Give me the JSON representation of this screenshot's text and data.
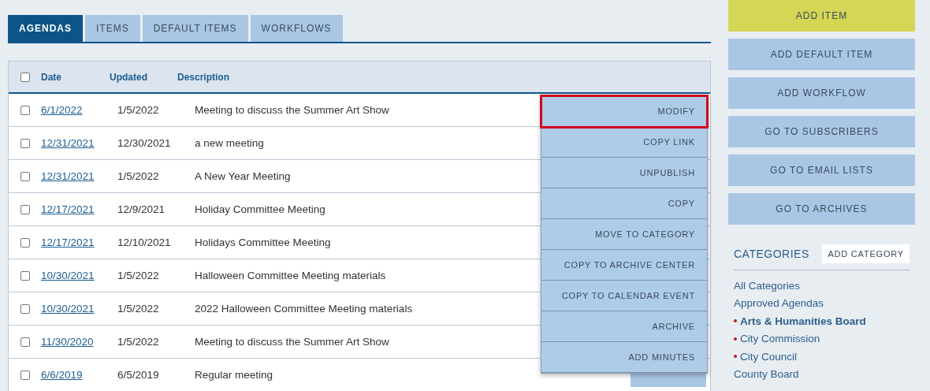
{
  "tabs": [
    {
      "label": "AGENDAS",
      "selected": true
    },
    {
      "label": "ITEMS",
      "selected": false
    },
    {
      "label": "DEFAULT ITEMS",
      "selected": false
    },
    {
      "label": "WORKFLOWS",
      "selected": false
    }
  ],
  "table": {
    "header_checkbox": {
      "checked": false
    },
    "columns": [
      "Date",
      "Updated",
      "Description"
    ],
    "rows": [
      {
        "checked": false,
        "date": "6/1/2022",
        "updated": "1/5/2022",
        "description": "Meeting to discuss the Summer Art Show"
      },
      {
        "checked": false,
        "date": "12/31/2021",
        "updated": "12/30/2021",
        "description": "a new meeting"
      },
      {
        "checked": false,
        "date": "12/31/2021",
        "updated": "1/5/2022",
        "description": "A New Year Meeting"
      },
      {
        "checked": false,
        "date": "12/17/2021",
        "updated": "12/9/2021",
        "description": "Holiday Committee Meeting"
      },
      {
        "checked": false,
        "date": "12/17/2021",
        "updated": "12/10/2021",
        "description": "Holidays Committee Meeting"
      },
      {
        "checked": false,
        "date": "10/30/2021",
        "updated": "1/5/2022",
        "description": "Halloween Committee Meeting materials"
      },
      {
        "checked": false,
        "date": "10/30/2021",
        "updated": "1/5/2022",
        "description": "2022 Halloween Committee Meeting materials"
      },
      {
        "checked": false,
        "date": "11/30/2020",
        "updated": "1/5/2022",
        "description": "Meeting to discuss the Summer Art Show"
      },
      {
        "checked": false,
        "date": "6/6/2019",
        "updated": "6/5/2019",
        "description": "Regular meeting",
        "actions_button": true
      }
    ]
  },
  "actions_menu": [
    {
      "label": "MODIFY",
      "selected": true
    },
    {
      "label": "COPY LINK",
      "selected": false
    },
    {
      "label": "UNPUBLISH",
      "selected": false
    },
    {
      "label": "COPY",
      "selected": false
    },
    {
      "label": "MOVE TO CATEGORY",
      "selected": false
    },
    {
      "label": "COPY TO ARCHIVE CENTER",
      "selected": false
    },
    {
      "label": "COPY TO CALENDAR EVENT",
      "selected": false
    },
    {
      "label": "ARCHIVE",
      "selected": false
    },
    {
      "label": "ADD MINUTES",
      "selected": false
    }
  ],
  "sidebar_buttons": [
    {
      "label": "ADD ITEM",
      "kind": "primary"
    },
    {
      "label": "ADD DEFAULT ITEM",
      "kind": "secondary"
    },
    {
      "label": "ADD WORKFLOW",
      "kind": "secondary"
    },
    {
      "label": "GO TO SUBSCRIBERS",
      "kind": "secondary"
    },
    {
      "label": "GO TO EMAIL LISTS",
      "kind": "secondary"
    },
    {
      "label": "GO TO ARCHIVES",
      "kind": "secondary"
    }
  ],
  "categories": {
    "title": "CATEGORIES",
    "add_button": "ADD CATEGORY",
    "items": [
      {
        "label": "All Categories",
        "kind": "plain",
        "selected": false
      },
      {
        "label": "Approved Agendas",
        "kind": "plain",
        "selected": false
      },
      {
        "label": "Arts & Humanities Board",
        "kind": "bullet",
        "selected": true
      },
      {
        "label": "City Commission",
        "kind": "bullet",
        "selected": false
      },
      {
        "label": "City Council",
        "kind": "bullet",
        "selected": false
      },
      {
        "label": "County Board",
        "kind": "plain",
        "selected": false
      }
    ]
  }
}
